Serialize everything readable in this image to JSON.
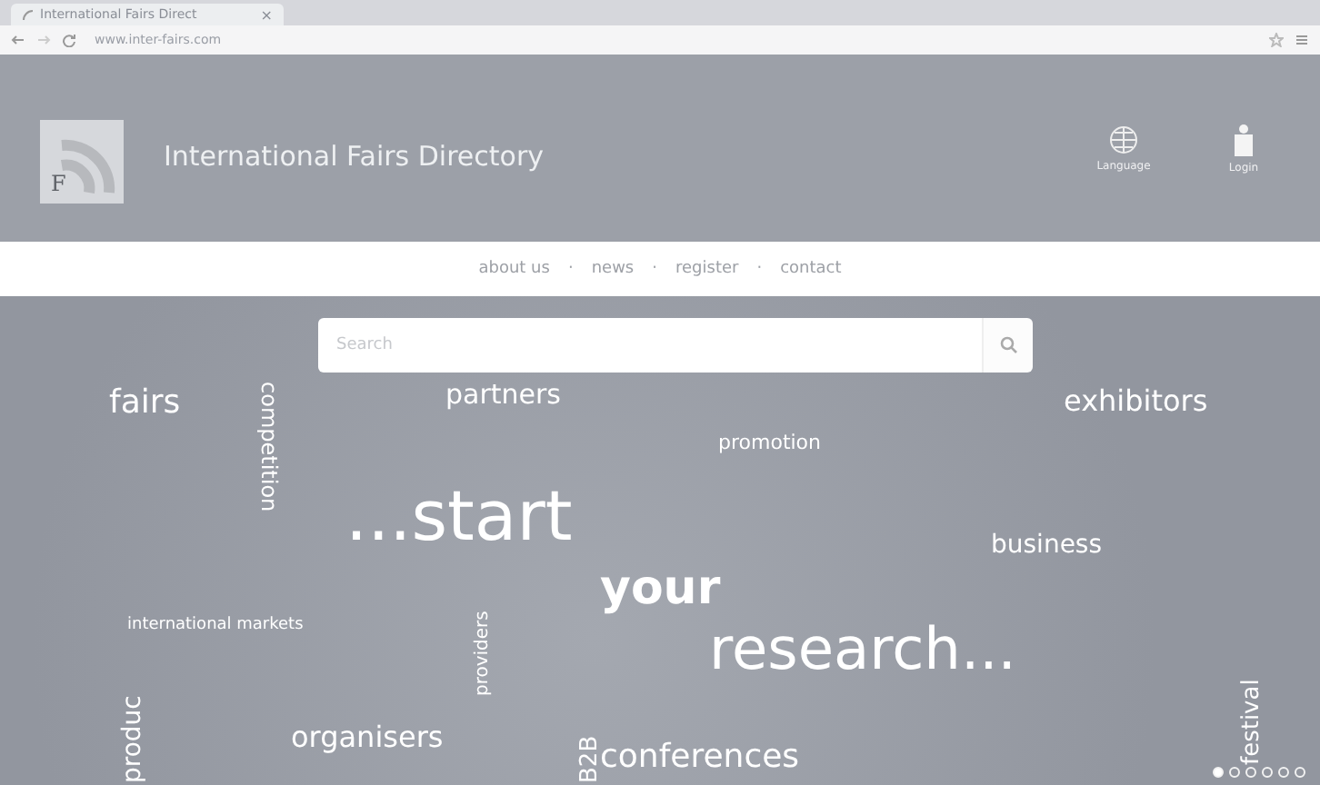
{
  "browser": {
    "tab_title": "International Fairs Direct",
    "tab_close": "×",
    "url": "www.inter-fairs.com"
  },
  "header": {
    "title": "International Fairs Directory",
    "logo_letter": "F",
    "actions": [
      "Language",
      "Login"
    ]
  },
  "nav": {
    "links": [
      "about us",
      "news",
      "register",
      "contact"
    ],
    "separator": "·"
  },
  "search": {
    "placeholder": "Search"
  },
  "hero": {
    "words": [
      {
        "text": "fairs",
        "kind": "plain"
      },
      {
        "text": "partners",
        "kind": "plain"
      },
      {
        "text": "competition",
        "kind": "vertical"
      },
      {
        "text": "promotion",
        "kind": "plain"
      },
      {
        "text": "exhibitors",
        "kind": "plain"
      },
      {
        "text": "...start",
        "kind": "plain"
      },
      {
        "text": "your",
        "kind": "bold"
      },
      {
        "text": "business",
        "kind": "plain"
      },
      {
        "text": "international markets",
        "kind": "plain"
      },
      {
        "text": "research...",
        "kind": "plain"
      },
      {
        "text": "providers",
        "kind": "vertical"
      },
      {
        "text": "produc",
        "kind": "vertical"
      },
      {
        "text": "organisers",
        "kind": "plain"
      },
      {
        "text": "B2B",
        "kind": "vertical"
      },
      {
        "text": "conferences",
        "kind": "plain"
      },
      {
        "text": "festival",
        "kind": "vertical"
      }
    ],
    "dots": [
      {
        "selected": true
      },
      {
        "selected": false
      },
      {
        "selected": false
      },
      {
        "selected": false
      },
      {
        "selected": false
      },
      {
        "selected": false
      }
    ]
  }
}
